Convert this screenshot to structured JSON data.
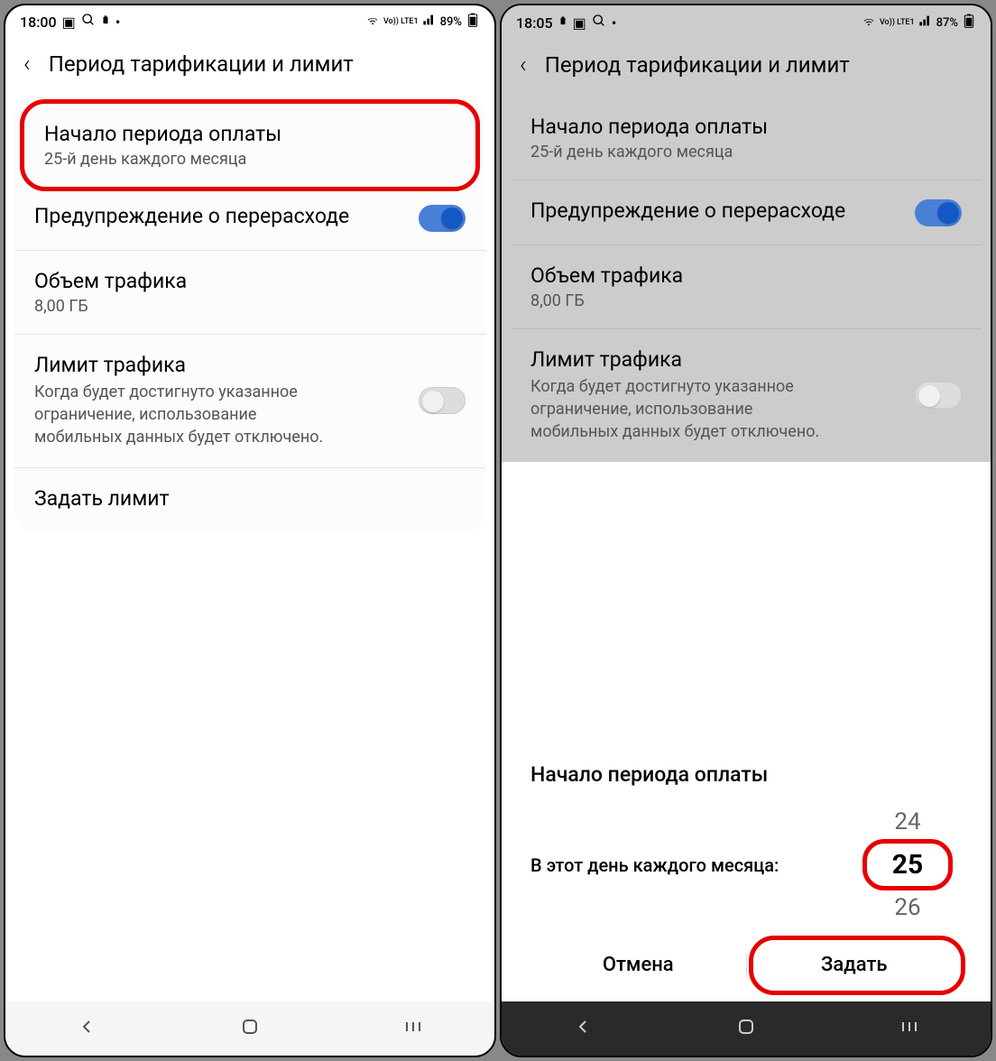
{
  "left": {
    "status": {
      "time": "18:00",
      "battery": "89%",
      "network": "Vo)) LTE1"
    },
    "header": {
      "title": "Период тарификации и лимит"
    },
    "settings": {
      "billing_start": {
        "title": "Начало периода оплаты",
        "subtitle": "25-й день каждого месяца"
      },
      "warning": {
        "title": "Предупреждение о перерасходе"
      },
      "volume": {
        "title": "Объем трафика",
        "subtitle": "8,00 ГБ"
      },
      "limit": {
        "title": "Лимит трафика",
        "description": "Когда будет достигнуто указанное ограничение, использование мобильных данных будет отключено."
      },
      "set_limit": {
        "title": "Задать лимит"
      }
    }
  },
  "right": {
    "status": {
      "time": "18:05",
      "battery": "87%",
      "network": "Vo)) LTE1"
    },
    "header": {
      "title": "Период тарификации и лимит"
    },
    "settings": {
      "billing_start": {
        "title": "Начало периода оплаты",
        "subtitle": "25-й день каждого месяца"
      },
      "warning": {
        "title": "Предупреждение о перерасходе"
      },
      "volume": {
        "title": "Объем трафика",
        "subtitle": "8,00 ГБ"
      },
      "limit": {
        "title": "Лимит трафика",
        "description": "Когда будет достигнуто указанное ограничение, использование мобильных данных будет отключено."
      }
    },
    "dialog": {
      "title": "Начало периода оплаты",
      "label": "В этот день каждого месяца:",
      "prev": "24",
      "current": "25",
      "next": "26",
      "cancel": "Отмена",
      "confirm": "Задать"
    }
  }
}
